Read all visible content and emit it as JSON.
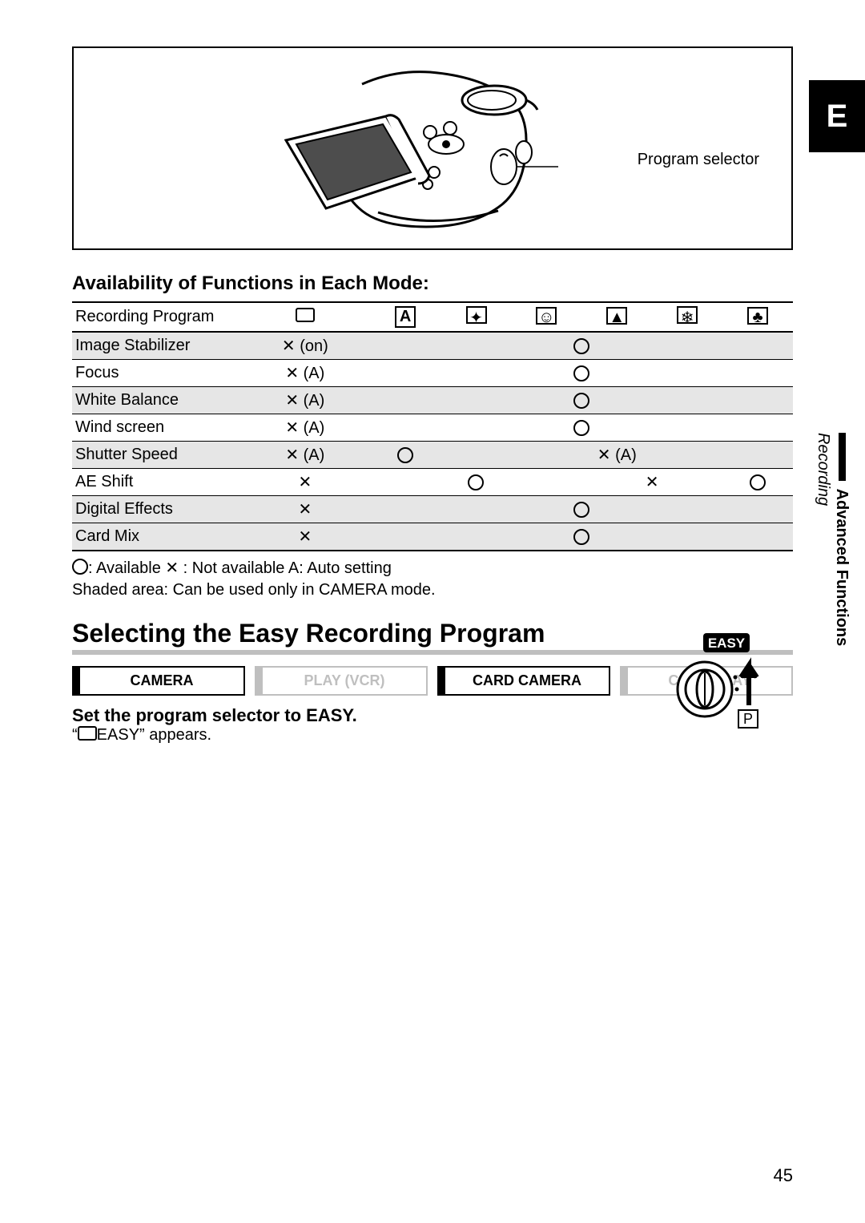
{
  "sideTab": "E",
  "illustrationLabel": "Program selector",
  "availabilityHeading": "Availability of Functions in Each Mode:",
  "table": {
    "headerRow": "Recording Program",
    "rows": [
      {
        "label": "Image Stabilizer",
        "col0": "✕ (on)",
        "rest": "○",
        "shade": true,
        "span": 7
      },
      {
        "label": "Focus",
        "col0": "✕ (A)",
        "rest": "○",
        "shade": false,
        "span": 7
      },
      {
        "label": "White Balance",
        "col0": "✕ (A)",
        "rest": "○",
        "shade": true,
        "span": 7
      },
      {
        "label": "Wind screen",
        "col0": "✕ (A)",
        "rest": "○",
        "shade": false,
        "span": 7
      },
      {
        "label": "Shutter Speed",
        "col0": "✕ (A)",
        "a": "○",
        "b": "✕ (A)",
        "shade": true
      },
      {
        "label": "AE Shift",
        "col0": "✕",
        "a": "○",
        "b": "✕",
        "c": "○",
        "shade": false
      },
      {
        "label": "Digital Effects",
        "col0": "✕",
        "rest": "○",
        "shade": true,
        "span": 7
      },
      {
        "label": "Card Mix",
        "col0": "✕",
        "rest": "○",
        "shade": true,
        "span": 7
      }
    ]
  },
  "legend1": ": Available    ✕ : Not available    A: Auto setting",
  "legend2": "Shaded area: Can be used only in CAMERA mode.",
  "sectionHeading": "Selecting the Easy Recording Program",
  "modes": [
    {
      "label": "CAMERA",
      "dim": false
    },
    {
      "label": "PLAY (VCR)",
      "dim": true
    },
    {
      "label": "CARD CAMERA",
      "dim": false
    },
    {
      "label": "CARD PLAY",
      "dim": true
    }
  ],
  "instruction": "Set the program selector to EASY.",
  "sub_a": "“",
  "sub_b": "EASY” appears.",
  "easyBadge": "EASY",
  "pBadge": "P",
  "sideText": {
    "a": "Advanced Functions",
    "b": "Recording"
  },
  "pageNum": "45"
}
